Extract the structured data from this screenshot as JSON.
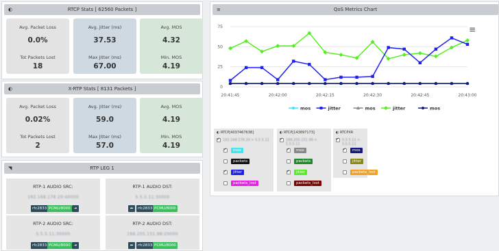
{
  "rtcp_stats": {
    "title": "RTCP Stats [ 62560 Packets ]",
    "cells": [
      {
        "label": "Avg. Packet Loss",
        "value": "0.0%"
      },
      {
        "label": "Avg. Jitter (ms)",
        "value": "37.53"
      },
      {
        "label": "Avg. MOS",
        "value": "4.32"
      },
      {
        "label": "Tot Packets Lost",
        "value": "18"
      },
      {
        "label": "Max Jitter (ms)",
        "value": "67.00"
      },
      {
        "label": "Min. MOS",
        "value": "4.19"
      }
    ]
  },
  "xrtp_stats": {
    "title": "X-RTP Stats [ 8131 Packets ]",
    "cells": [
      {
        "label": "Avg. Packet Loss",
        "value": "0.02%"
      },
      {
        "label": "Avg. Jitter (ms)",
        "value": "59.0"
      },
      {
        "label": "Avg. MOS",
        "value": "4.19"
      },
      {
        "label": "Tot Packets Lost",
        "value": "2"
      },
      {
        "label": "Max Jitter (ms)",
        "value": "57.0"
      },
      {
        "label": "Min. MOS",
        "value": "4.19"
      }
    ]
  },
  "rtp_leg": {
    "title": "RTP LEG 1",
    "cards": [
      {
        "label": "RTP-1 AUDIO SRC:",
        "ip": "192.168.178.20:40000",
        "codec1": "rfc2833",
        "codec2": "PCMU/8000"
      },
      {
        "label": "RTP-1 AUDIO DST:",
        "ip": "5.5.5.11:30000",
        "codec1": "rfc2833",
        "codec2": "PCMU/8000"
      },
      {
        "label": "RTP-2 AUDIO SRC:",
        "ip": "5.5.5.11:30000",
        "codec1": "rfc2833",
        "codec2": "PCMU/8000"
      },
      {
        "label": "RTP-2 AUDIO DST:",
        "ip": "188.205.151.98:20000",
        "codec1": "rfc2833",
        "codec2": "PCMU/8000"
      }
    ]
  },
  "qos": {
    "title": "QoS Metrics Chart",
    "menu_icon": "hamburger-icon"
  },
  "selectors": [
    {
      "title": "RTCP[4037467638]",
      "ip": "192.168.178.20 > 5.5.5.11",
      "items": [
        {
          "label": "mos",
          "color": "#3ee8f0",
          "text": "#fff",
          "checked": true
        },
        {
          "label": "packets",
          "color": "#111111",
          "text": "#fff",
          "checked": false
        },
        {
          "label": "jitter",
          "color": "#1e1eee",
          "text": "#fff",
          "checked": true
        },
        {
          "label": "packets_lost",
          "color": "#e81ee8",
          "text": "#fff",
          "checked": false
        }
      ]
    },
    {
      "title": "RTCP[143897173]",
      "ip": "188.205.151.98 > 5.5.5.11",
      "items": [
        {
          "label": "mos",
          "color": "#888888",
          "text": "#fff",
          "checked": true
        },
        {
          "label": "packets",
          "color": "#1d8a2a",
          "text": "#fff",
          "checked": false
        },
        {
          "label": "jitter",
          "color": "#55ee22",
          "text": "#fff",
          "checked": true
        },
        {
          "label": "packets_lost",
          "color": "#7a0000",
          "text": "#fff",
          "checked": false
        }
      ]
    },
    {
      "title": "RTCPXR",
      "ip": "5.5.5.11 > 5.5.5.11",
      "items": [
        {
          "label": "mos",
          "color": "#151a7a",
          "text": "#fff",
          "checked": true
        },
        {
          "label": "jitter",
          "color": "#8a8a10",
          "text": "#fff",
          "checked": false
        },
        {
          "label": "packets_lost",
          "color": "#f3a020",
          "text": "#fff",
          "checked": false
        }
      ]
    }
  ],
  "chart_data": {
    "type": "line",
    "x": [
      "20:41:45",
      "20:41:50",
      "20:41:55",
      "20:42:00",
      "20:42:05",
      "20:42:10",
      "20:42:15",
      "20:42:20",
      "20:42:25",
      "20:42:30",
      "20:42:35",
      "20:42:40",
      "20:42:45",
      "20:42:50",
      "20:42:55",
      "20:43:00"
    ],
    "x_ticks": [
      "20:41:45",
      "20:42:00",
      "20:42:15",
      "20:42:30",
      "20:42:45",
      "20:43:00"
    ],
    "y_ticks": [
      0,
      25,
      50,
      75
    ],
    "ylim": [
      0,
      75
    ],
    "series": [
      {
        "name": "mos",
        "color": "#3ee8f0",
        "marker": "circle",
        "values": [
          4.3,
          4.3,
          4.3,
          4.3,
          4.3,
          4.3,
          4.3,
          4.3,
          4.3,
          4.3,
          4.3,
          4.3,
          4.3,
          4.3,
          4.3,
          4.3
        ]
      },
      {
        "name": "jitter",
        "color": "#1e1eee",
        "marker": "square",
        "values": [
          8,
          24,
          24,
          9,
          32,
          28,
          9,
          12,
          12,
          13,
          49,
          47,
          30,
          47,
          61,
          53
        ]
      },
      {
        "name": "mos",
        "color": "#888888",
        "marker": "triangle",
        "values": [
          4.3,
          4.3,
          4.3,
          4.3,
          4.3,
          4.3,
          4.3,
          4.3,
          4.3,
          4.3,
          4.3,
          4.3,
          4.3,
          4.3,
          4.3,
          4.3
        ]
      },
      {
        "name": "jitter",
        "color": "#55ee22",
        "marker": "diamond",
        "values": [
          48,
          57,
          44,
          51,
          51,
          67,
          43,
          40,
          36,
          56,
          35,
          40,
          42,
          38,
          49,
          58
        ]
      },
      {
        "name": "mos",
        "color": "#151a7a",
        "marker": "circle",
        "values": [
          4.2,
          4.2,
          4.2,
          4.2,
          4.2,
          4.2,
          4.2,
          4.2,
          4.2,
          4.2,
          4.2,
          4.2,
          4.2,
          4.2,
          4.2,
          4.2
        ]
      }
    ]
  }
}
